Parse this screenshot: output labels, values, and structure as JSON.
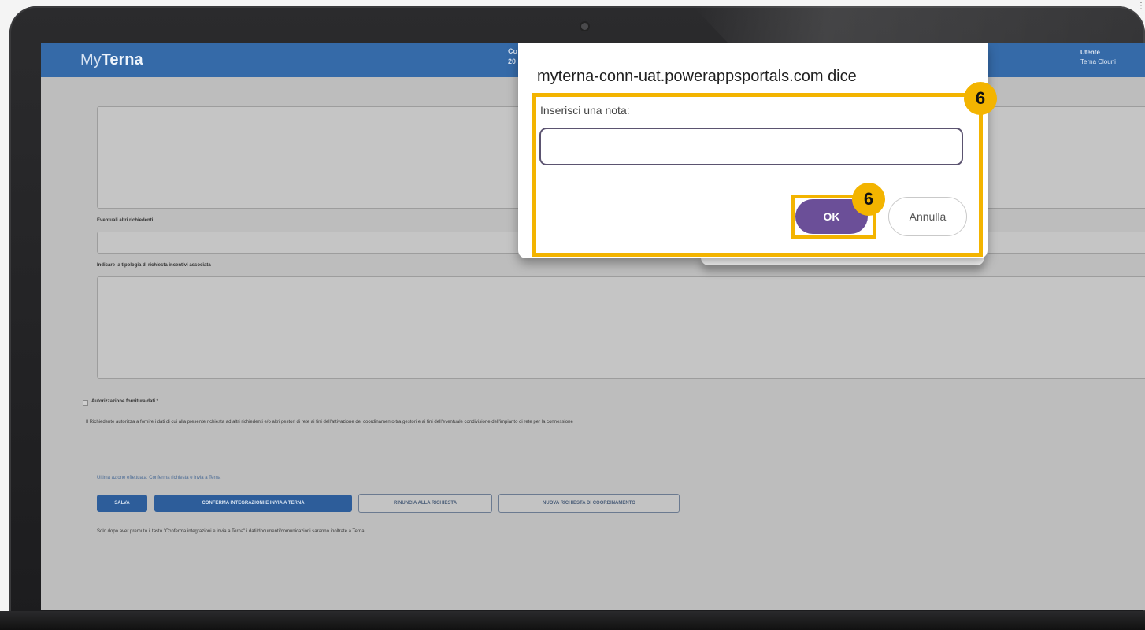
{
  "app": {
    "logo_prefix": "My",
    "logo_suffix": "Terna",
    "header_mid_line1": "Co",
    "header_mid_line2": "20",
    "user_label": "Utente",
    "user_name": "Terna Clouni"
  },
  "form": {
    "label_other_applicants": "Eventuali altri richiedenti",
    "label_incentive_type": "Indicare la tipologia di richiesta incentivi associata",
    "label_authorization": "Autorizzazione fornitura dati *",
    "authorization_text": "Il Richiedente autorizza a fornire i dati di cui alla presente richiesta ad altri richiedenti e/o altri gestori di rete ai fini dell'attivazione del coordinamento tra gestori e ai fini dell'eventuale condivisione dell'impianto di rete per la connessione",
    "last_action_text": "Ultima azione effettuata: Conferma richiesta e invia a Terna",
    "footer_note": "Solo dopo aver premuto il tasto \"Conferma integrazioni e invia a Terna\" i dati/documenti/comunicazioni saranno inoltrate a Terna"
  },
  "actions": {
    "save": "SALVA",
    "confirm_send": "CONFERMA INTEGRAZIONI E INVIA A TERNA",
    "waive": "RINUNCIA ALLA RICHIESTA",
    "new_request": "NUOVA RICHIESTA DI COORDINAMENTO"
  },
  "dialog": {
    "title": "myterna-conn-uat.powerappsportals.com dice",
    "prompt_label": "Inserisci una nota:",
    "input_value": "",
    "ok_label": "OK",
    "cancel_label": "Annulla"
  },
  "annotations": {
    "step_frame": "6",
    "step_ok": "6",
    "highlight_color": "#f3b400"
  },
  "colors": {
    "header_blue": "#356aa8",
    "primary_button": "#2d5d9a",
    "ok_button": "#6b4f98"
  }
}
